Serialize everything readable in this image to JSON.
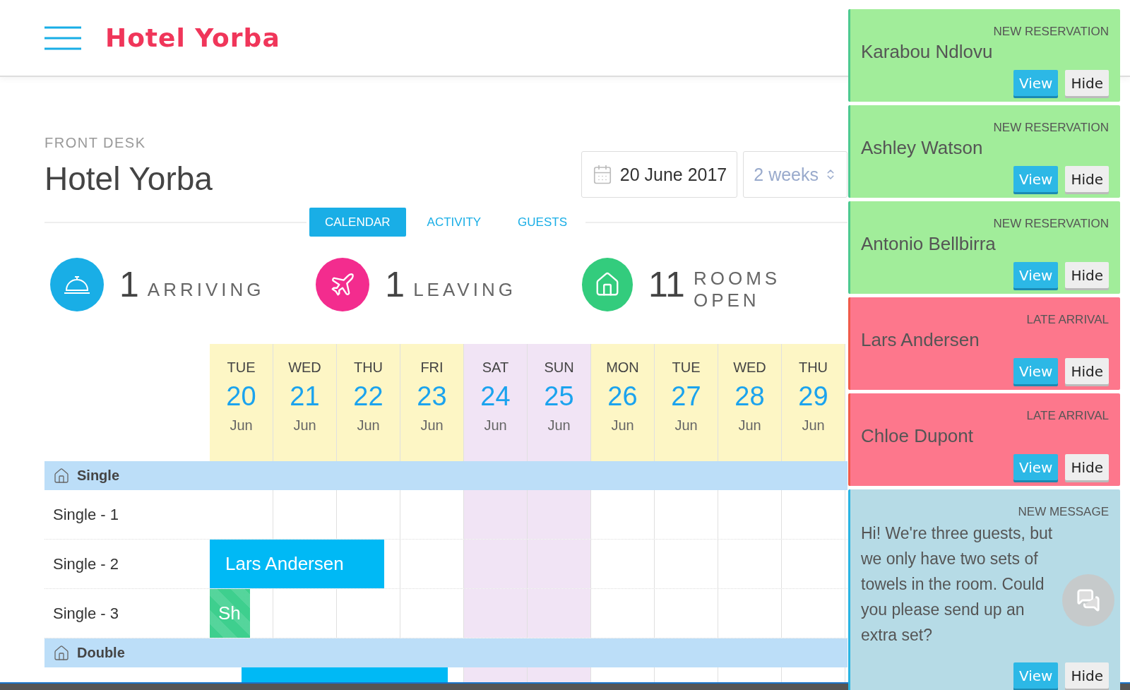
{
  "header": {
    "brand": "Hotel Yorba"
  },
  "page": {
    "eyebrow": "FRONT DESK",
    "title": "Hotel Yorba"
  },
  "date_picker": {
    "value": "20 June 2017"
  },
  "range_select": {
    "value": "2 weeks"
  },
  "tabs": [
    {
      "label": "CALENDAR",
      "selected": true
    },
    {
      "label": "ACTIVITY",
      "selected": false
    },
    {
      "label": "GUESTS",
      "selected": false
    }
  ],
  "stats": [
    {
      "kind": "arriving",
      "count": "1",
      "label": "ARRIVING"
    },
    {
      "kind": "leaving",
      "count": "1",
      "label": "LEAVING"
    },
    {
      "kind": "rooms",
      "count": "11",
      "label": "ROOMS OPEN"
    }
  ],
  "calendar": {
    "days": [
      {
        "weekday": "TUE",
        "date": "20",
        "month": "Jun",
        "weekend": false
      },
      {
        "weekday": "WED",
        "date": "21",
        "month": "Jun",
        "weekend": false
      },
      {
        "weekday": "THU",
        "date": "22",
        "month": "Jun",
        "weekend": false
      },
      {
        "weekday": "FRI",
        "date": "23",
        "month": "Jun",
        "weekend": false
      },
      {
        "weekday": "SAT",
        "date": "24",
        "month": "Jun",
        "weekend": true
      },
      {
        "weekday": "SUN",
        "date": "25",
        "month": "Jun",
        "weekend": true
      },
      {
        "weekday": "MON",
        "date": "26",
        "month": "Jun",
        "weekend": false
      },
      {
        "weekday": "TUE",
        "date": "27",
        "month": "Jun",
        "weekend": false
      },
      {
        "weekday": "WED",
        "date": "28",
        "month": "Jun",
        "weekend": false
      },
      {
        "weekday": "THU",
        "date": "29",
        "month": "Jun",
        "weekend": false
      }
    ],
    "groups": [
      {
        "name": "Single",
        "rooms": [
          {
            "name": "Single - 1"
          },
          {
            "name": "Single - 2",
            "bookings": [
              {
                "guest": "Lars Andersen",
                "color": "#00b9f5"
              }
            ]
          },
          {
            "name": "Single - 3",
            "bookings": [
              {
                "guest": "Sh",
                "color": "#3ecf8e"
              }
            ]
          }
        ]
      },
      {
        "name": "Double",
        "rooms": [
          {
            "bookings": [
              {
                "color": "#00b9f5"
              }
            ]
          }
        ]
      }
    ]
  },
  "notifications": [
    {
      "kind": "reservation",
      "type": "NEW RESERVATION",
      "title": "Karabou Ndlovu",
      "buttons": [
        "View",
        "Hide"
      ]
    },
    {
      "kind": "reservation",
      "type": "NEW RESERVATION",
      "title": "Ashley Watson",
      "buttons": [
        "View",
        "Hide"
      ]
    },
    {
      "kind": "reservation",
      "type": "NEW RESERVATION",
      "title": "Antonio Bellbirra",
      "buttons": [
        "View",
        "Hide"
      ]
    },
    {
      "kind": "late",
      "type": "LATE ARRIVAL",
      "title": "Lars Andersen",
      "buttons": [
        "View",
        "Hide"
      ]
    },
    {
      "kind": "late",
      "type": "LATE ARRIVAL",
      "title": "Chloe Dupont",
      "buttons": [
        "View",
        "Hide"
      ]
    },
    {
      "kind": "message",
      "type": "NEW MESSAGE",
      "title": "Hi! We're three guests, but we only have two sets of towels in the room. Could you please send up an extra set?",
      "buttons": [
        "View",
        "Hide"
      ]
    }
  ]
}
